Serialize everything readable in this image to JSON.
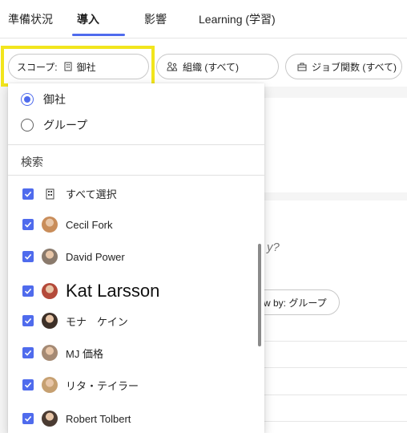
{
  "tabs": [
    {
      "label": "準備状況",
      "active": false
    },
    {
      "label": "導入",
      "active": true
    },
    {
      "label": "影響",
      "active": false
    },
    {
      "label": "Learning (学習)",
      "active": false
    }
  ],
  "filters": {
    "scope": {
      "prefix": "スコープ:",
      "value": "御社",
      "icon": "building-icon"
    },
    "org": {
      "label": "組織 (すべて)",
      "icon": "people-icon"
    },
    "job": {
      "label": "ジョブ関数 (すべて)",
      "icon": "briefcase-icon"
    }
  },
  "dropdown": {
    "options": [
      {
        "label": "御社",
        "selected": true
      },
      {
        "label": "グループ",
        "selected": false
      }
    ],
    "search_label": "検索",
    "select_all": "すべて選択",
    "people": [
      {
        "name": "Cecil Fork",
        "checked": true,
        "avatar_color": "#c98d5a"
      },
      {
        "name": "David Power",
        "checked": true,
        "avatar_color": "#8a7a6c"
      },
      {
        "name": "Kat Larsson",
        "checked": true,
        "avatar_color": "#b44a3a"
      },
      {
        "name": "モナ　ケイン",
        "checked": true,
        "avatar_color": "#3d3028"
      },
      {
        "name": "MJ 価格",
        "checked": true,
        "avatar_color": "#a58a74"
      },
      {
        "name": "リタ・テイラー",
        "checked": true,
        "avatar_color": "#c6a071"
      },
      {
        "name": "Robert Tolbert",
        "checked": true,
        "avatar_color": "#4a3b32"
      }
    ]
  },
  "background": {
    "question_mark": "y?",
    "view_by": "w by: グループ"
  },
  "colors": {
    "accent": "#4f6bed",
    "highlight": "#f2e51d"
  }
}
